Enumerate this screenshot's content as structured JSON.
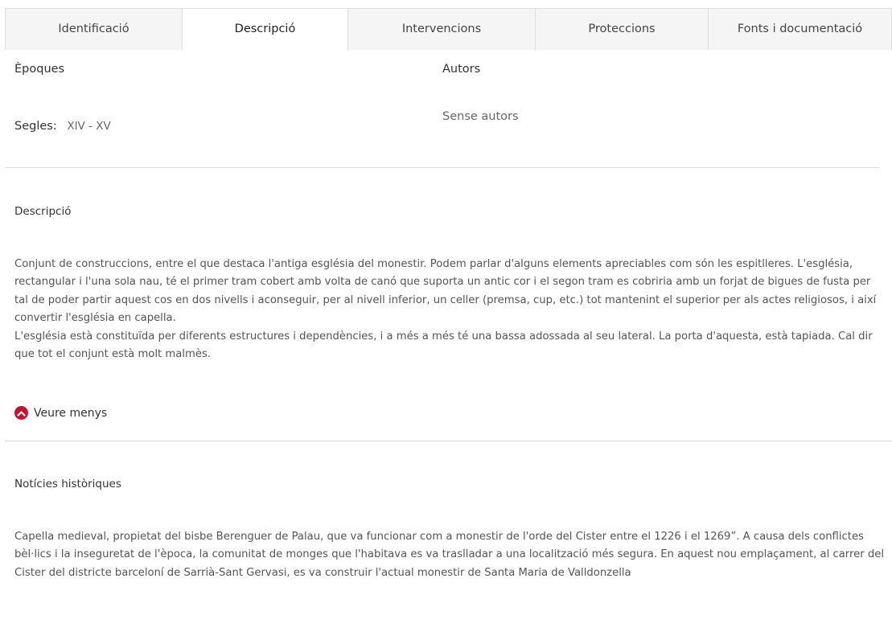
{
  "tabs": [
    {
      "label": "Identificació",
      "active": false
    },
    {
      "label": "Descripció",
      "active": true
    },
    {
      "label": "Intervencions",
      "active": false
    },
    {
      "label": "Proteccions",
      "active": false
    },
    {
      "label": "Fonts i documentació",
      "active": false
    }
  ],
  "epoques": {
    "heading": "Èpoques",
    "segles_label": "Segles:",
    "segles_value": "XIV - XV"
  },
  "autors": {
    "heading": "Autors",
    "value": "Sense autors"
  },
  "descripcio": {
    "title": "Descripció",
    "paragraphs": [
      "Conjunt de construccions, entre el que destaca l'antiga església del monestir. Podem parlar d'alguns elements apreciables com són les espitlleres. L'església, rectangular i l'una sola nau, té el primer tram cobert amb volta de canó que suporta un antic cor i el segon tram es cobriria amb un forjat de bigues de fusta per tal de poder partir aquest cos en dos nivells i aconseguir, per al nivell inferior, un celler (premsa, cup, etc.) tot mantenint el superior per als actes religiosos, i així convertir l'església en capella.",
      "L'església està constituïda per diferents estructures i dependències, i a més a més té una bassa adossada al seu lateral. La porta d'aquesta, està tapiada. Cal dir que tot el conjunt està molt malmès."
    ],
    "toggle_label": "Veure menys",
    "toggle_icon": "chevron-up-circle-icon",
    "accent_color": "#c8102e"
  },
  "noticies": {
    "title": "Notícies històriques",
    "paragraphs": [
      "Capella medieval, propietat del bisbe Berenguer de Palau, que va funcionar com a monestir de l'orde del Cister entre el 1226 i el 1269”. A causa dels conflictes bèl·lics i la inseguretat de l'època, la comunitat de monges que l'habitava es va traslladar a una localització més segura. En aquest nou emplaçament, al carrer del Cister del districte barceloní de Sarrià-Sant Gervasi, es va construir l'actual monestir de Santa Maria de Valldonzella"
    ]
  }
}
